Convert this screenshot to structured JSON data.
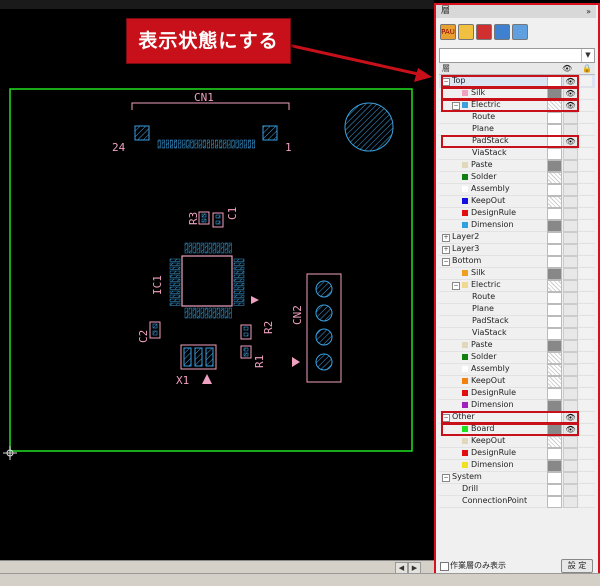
{
  "callout": {
    "text": "表示状態にする"
  },
  "pcb": {
    "cn1": "CN1",
    "cn1_pin_left": "24",
    "cn1_pin_right": "1",
    "r3": "R3",
    "c1": "C1",
    "ic1": "IC1",
    "cn2": "CN2",
    "c2": "C2",
    "r2": "R2",
    "r1": "R1",
    "x1": "X1"
  },
  "panel": {
    "title": "層",
    "collapse": "»",
    "toolbar": [
      "PAU",
      "",
      "",
      "",
      ""
    ],
    "dropdown_value": "",
    "header_label": "層",
    "rows": [
      {
        "label": "Top",
        "level": 0,
        "exp": "−",
        "color": "",
        "colbox": "",
        "vis": "👁",
        "sel": true
      },
      {
        "label": "Silk",
        "level": 1,
        "exp": "",
        "color": "#f0a0c0",
        "colbox": "gray",
        "vis": "👁"
      },
      {
        "label": "Electric",
        "level": 1,
        "exp": "−",
        "color": "#3aa0e0",
        "colbox": "hatch",
        "vis": "👁"
      },
      {
        "label": "Route",
        "level": 2,
        "exp": "",
        "color": "",
        "colbox": "",
        "vis": ""
      },
      {
        "label": "Plane",
        "level": 2,
        "exp": "",
        "color": "",
        "colbox": "",
        "vis": ""
      },
      {
        "label": "PadStack",
        "level": 2,
        "exp": "",
        "color": "",
        "colbox": "",
        "vis": "👁"
      },
      {
        "label": "ViaStack",
        "level": 2,
        "exp": "",
        "color": "",
        "colbox": "",
        "vis": ""
      },
      {
        "label": "Paste",
        "level": 1,
        "exp": "",
        "color": "#e0d8b8",
        "colbox": "gray",
        "vis": ""
      },
      {
        "label": "Solder",
        "level": 1,
        "exp": "",
        "color": "#108010",
        "colbox": "hatch",
        "vis": ""
      },
      {
        "label": "Assembly",
        "level": 1,
        "exp": "",
        "color": "#ffffff",
        "colbox": "",
        "vis": ""
      },
      {
        "label": "KeepOut",
        "level": 1,
        "exp": "",
        "color": "#1010e0",
        "colbox": "hatch",
        "vis": ""
      },
      {
        "label": "DesignRule",
        "level": 1,
        "exp": "",
        "color": "#e01010",
        "colbox": "",
        "vis": ""
      },
      {
        "label": "Dimension",
        "level": 1,
        "exp": "",
        "color": "#30a0e0",
        "colbox": "gray",
        "vis": ""
      },
      {
        "label": "Layer2",
        "level": 0,
        "exp": "+",
        "color": "",
        "colbox": "",
        "vis": ""
      },
      {
        "label": "Layer3",
        "level": 0,
        "exp": "+",
        "color": "",
        "colbox": "",
        "vis": ""
      },
      {
        "label": "Bottom",
        "level": 0,
        "exp": "−",
        "color": "",
        "colbox": "",
        "vis": ""
      },
      {
        "label": "Silk",
        "level": 1,
        "exp": "",
        "color": "#f0a020",
        "colbox": "gray",
        "vis": ""
      },
      {
        "label": "Electric",
        "level": 1,
        "exp": "−",
        "color": "#f0d890",
        "colbox": "hatch",
        "vis": ""
      },
      {
        "label": "Route",
        "level": 2,
        "exp": "",
        "color": "",
        "colbox": "",
        "vis": ""
      },
      {
        "label": "Plane",
        "level": 2,
        "exp": "",
        "color": "",
        "colbox": "",
        "vis": ""
      },
      {
        "label": "PadStack",
        "level": 2,
        "exp": "",
        "color": "",
        "colbox": "",
        "vis": ""
      },
      {
        "label": "ViaStack",
        "level": 2,
        "exp": "",
        "color": "",
        "colbox": "",
        "vis": ""
      },
      {
        "label": "Paste",
        "level": 1,
        "exp": "",
        "color": "#e0d8b8",
        "colbox": "gray",
        "vis": ""
      },
      {
        "label": "Solder",
        "level": 1,
        "exp": "",
        "color": "#108010",
        "colbox": "hatch",
        "vis": ""
      },
      {
        "label": "Assembly",
        "level": 1,
        "exp": "",
        "color": "#ffffff",
        "colbox": "hatch",
        "vis": ""
      },
      {
        "label": "KeepOut",
        "level": 1,
        "exp": "",
        "color": "#f08010",
        "colbox": "hatch",
        "vis": ""
      },
      {
        "label": "DesignRule",
        "level": 1,
        "exp": "",
        "color": "#e01010",
        "colbox": "",
        "vis": ""
      },
      {
        "label": "Dimension",
        "level": 1,
        "exp": "",
        "color": "#a020c0",
        "colbox": "gray",
        "vis": ""
      },
      {
        "label": "Other",
        "level": 0,
        "exp": "−",
        "color": "",
        "colbox": "",
        "vis": "👁"
      },
      {
        "label": "Board",
        "level": 1,
        "exp": "",
        "color": "#20e020",
        "colbox": "gray",
        "vis": "👁"
      },
      {
        "label": "KeepOut",
        "level": 1,
        "exp": "",
        "color": "#e0d8b8",
        "colbox": "hatch",
        "vis": ""
      },
      {
        "label": "DesignRule",
        "level": 1,
        "exp": "",
        "color": "#e01010",
        "colbox": "",
        "vis": ""
      },
      {
        "label": "Dimension",
        "level": 1,
        "exp": "",
        "color": "#f0e020",
        "colbox": "gray",
        "vis": ""
      },
      {
        "label": "System",
        "level": 0,
        "exp": "−",
        "color": "",
        "colbox": "",
        "vis": ""
      },
      {
        "label": "Drill",
        "level": 1,
        "exp": "",
        "color": "",
        "colbox": "",
        "vis": ""
      },
      {
        "label": "ConnectionPoint",
        "level": 1,
        "exp": "",
        "color": "",
        "colbox": "",
        "vis": ""
      }
    ],
    "footer": {
      "checkbox_label": "作業層のみ表示",
      "settings_button": "設 定"
    }
  }
}
